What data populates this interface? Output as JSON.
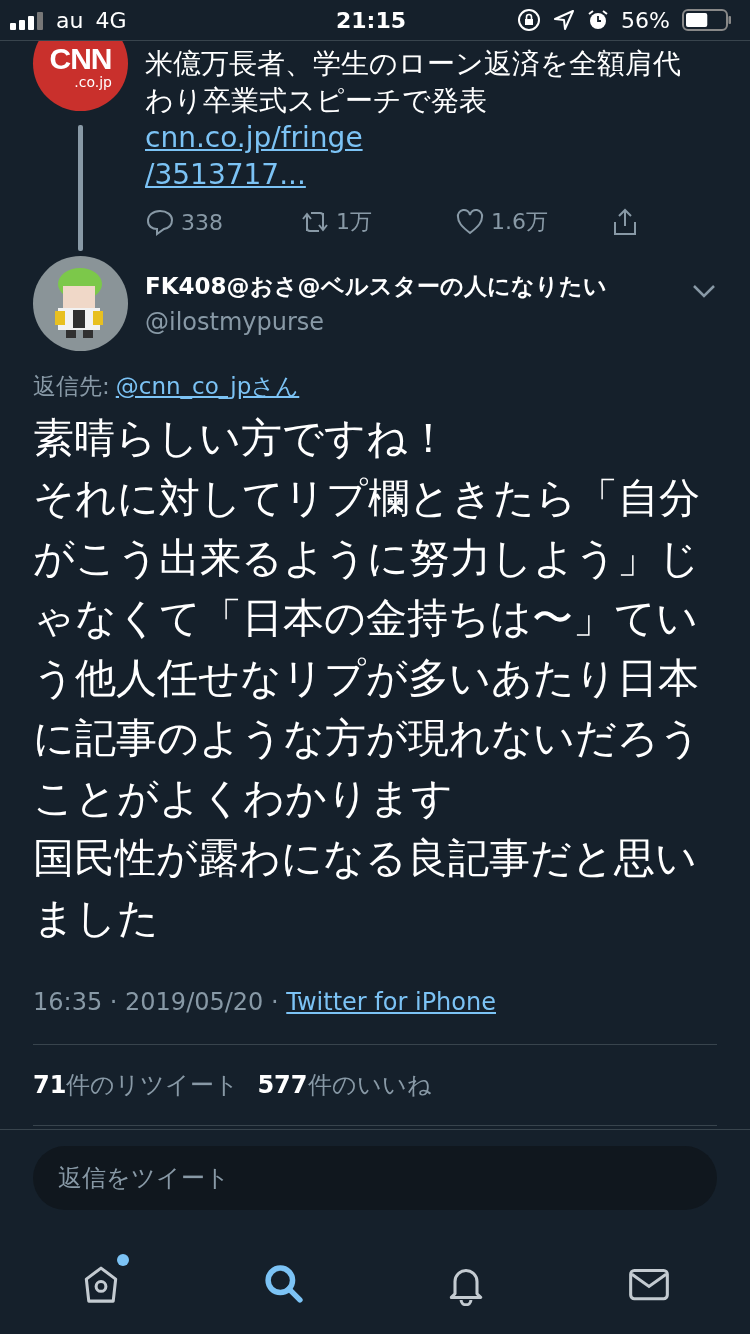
{
  "status_bar": {
    "carrier": "au",
    "network": "4G",
    "time": "21:15",
    "battery": "56%"
  },
  "quoted_tweet": {
    "logo": {
      "name": "CNN",
      "sub": ".co.jp"
    },
    "text": "米億万長者、学生のローン返済を全額肩代わり卒業式スピーチで発表",
    "link": "cnn.co.jp/fringe/3513717...",
    "replies": "338",
    "retweets": "1万",
    "likes": "1.6万"
  },
  "tweet": {
    "name": "FK408@おさ@ベルスターの人になりたい",
    "handle": "@ilostmypurse",
    "reply_label": "返信先:",
    "reply_to": "@cnn_co_jpさん",
    "body": [
      "素晴らしい方ですね！",
      "それに対してリプ欄ときたら「自分がこう出来るように努力しよう」じゃなくて「日本の金持ちは〜」ていう他人任せなリプが多いあたり日本に記事のような方が現れないだろうことがよくわかります",
      "国民性が露わになる良記事だと思いました"
    ],
    "meta": "16:35 · 2019/05/20 · ",
    "source": "Twitter for iPhone",
    "retweet_count": "71",
    "retweet_label": "件のリツイート",
    "like_count": "577",
    "like_label": "件のいいね"
  },
  "reply_field": {
    "placeholder": "返信をツイート"
  },
  "tab_bar": [
    {
      "kind": "home",
      "selected": false,
      "badge": true
    },
    {
      "kind": "search",
      "selected": true,
      "badge": false
    },
    {
      "kind": "notifications",
      "selected": false,
      "badge": false
    },
    {
      "kind": "messages",
      "selected": false,
      "badge": false
    }
  ]
}
